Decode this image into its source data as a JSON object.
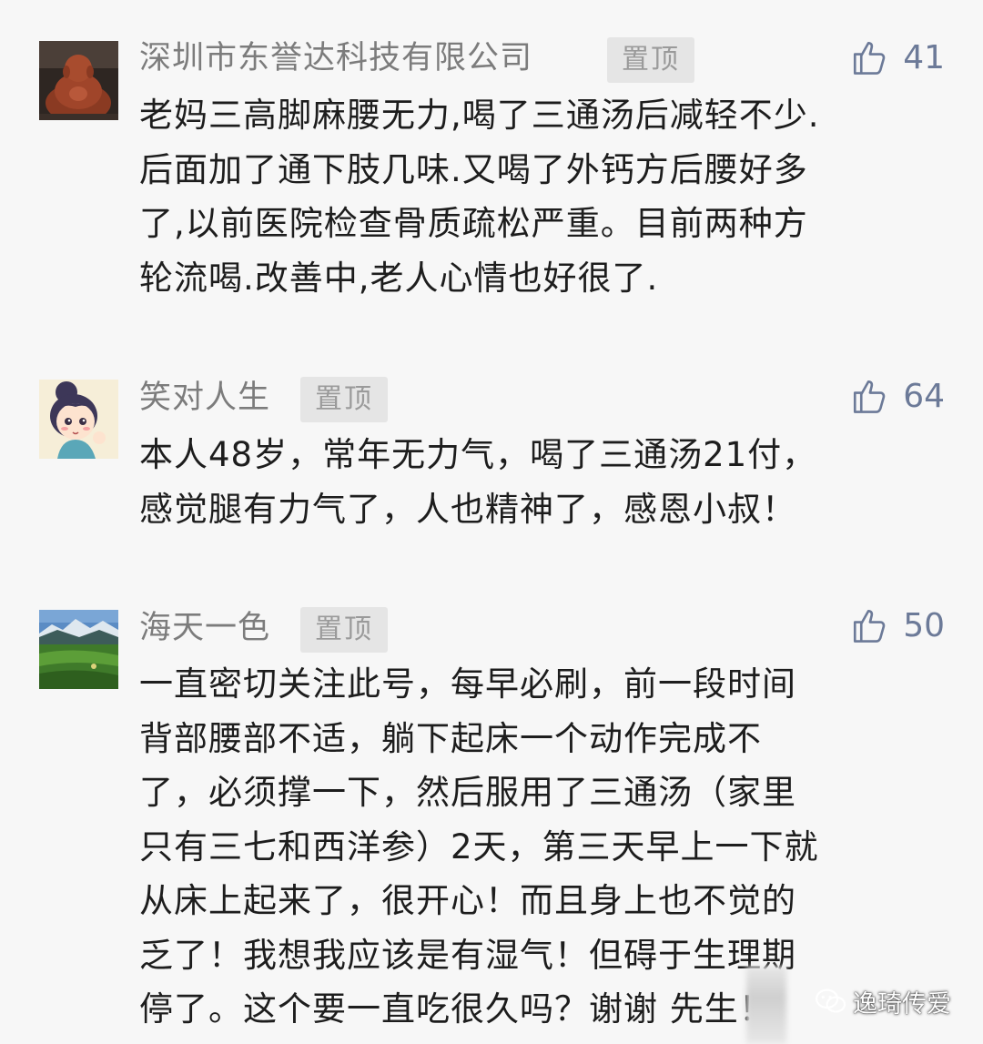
{
  "comments": [
    {
      "author": "深圳市东誉达科技有限公司",
      "badge": "置顶",
      "likes": "41",
      "avatar": "buddha-figurine-avatar",
      "lines": [
        "老妈三高脚麻腰无力,喝了三通汤后减轻不少.",
        "后面加了通下肢几味.又喝了外钙方后腰好多",
        "了,以前医院检查骨质疏松严重。目前两种方",
        "轮流喝.改善中,老人心情也好很了."
      ]
    },
    {
      "author": "笑对人生",
      "badge": "置顶",
      "likes": "64",
      "avatar": "cartoon-girl-avatar",
      "lines": [
        "本人48岁，常年无力气，喝了三通汤21付，",
        "感觉腿有力气了，人也精神了，感恩小叔！"
      ]
    },
    {
      "author": "海天一色",
      "badge": "置顶",
      "likes": "50",
      "avatar": "landscape-avatar",
      "lines": [
        "一直密切关注此号，每早必刷，前一段时间",
        "背部腰部不适，躺下起床一个动作完成不",
        "了，必须撑一下，然后服用了三通汤（家里",
        "只有三七和西洋参）2天，第三天早上一下就",
        "从床上起来了，很开心！而且身上也不觉的",
        "乏了！我想我应该是有湿气！但碍于生理期",
        "停了。这个要一直吃很久吗？谢谢  先生！"
      ]
    }
  ],
  "watermark": {
    "text": "逸琦传爱",
    "icon": "wechat-icon"
  },
  "colors": {
    "background": "#f7f7f7",
    "author": "#7c7c7c",
    "badge_bg": "#e5e5e5",
    "like": "#6c7a98",
    "text": "#1d1d1d"
  }
}
